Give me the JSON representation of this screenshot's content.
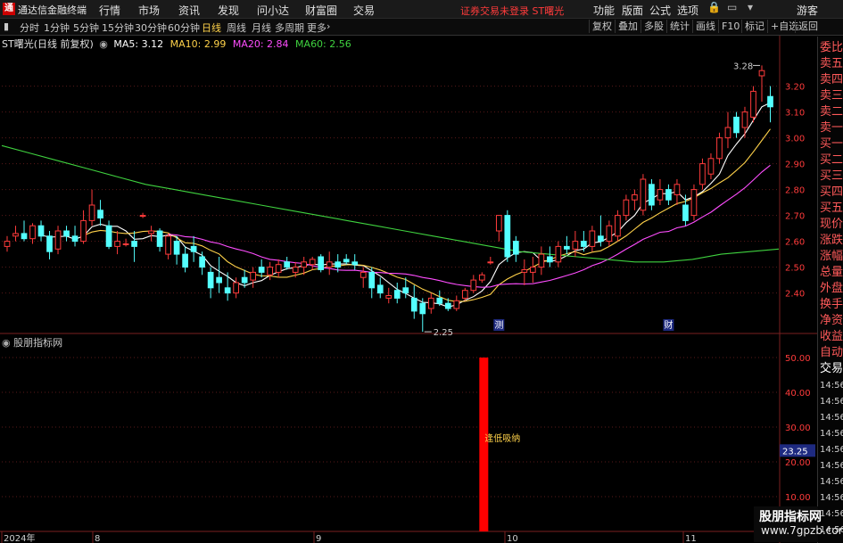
{
  "window": {
    "app_title": "通达信金融终端",
    "logo": "通",
    "menus": [
      "行情",
      "市场",
      "资讯",
      "发现",
      "问小达",
      "财富圈",
      "交易"
    ],
    "login_warning": "证券交易未登录  ST曙光",
    "right_menus": [
      "功能",
      "版面",
      "公式",
      "选项"
    ],
    "guest": "游客"
  },
  "toolbar": {
    "periods": [
      "分时",
      "1分钟",
      "5分钟",
      "15分钟",
      "30分钟",
      "60分钟",
      "日线",
      "周线",
      "月线",
      "多周期",
      "更多"
    ],
    "active_period": "日线",
    "buttons": [
      "复权",
      "叠加",
      "多股",
      "统计",
      "画线",
      "F10",
      "标记",
      "+自选",
      "返回"
    ]
  },
  "legend": {
    "stock": "ST曙光(日线 前复权)",
    "ma": [
      {
        "label": "MA5: 3.12",
        "color": "#ffffff"
      },
      {
        "label": "MA10: 2.99",
        "color": "#ffd24a"
      },
      {
        "label": "MA20: 2.84",
        "color": "#ff4dff"
      },
      {
        "label": "MA60: 2.56",
        "color": "#3fd23f"
      }
    ]
  },
  "price_axis": [
    "3.20",
    "3.10",
    "3.00",
    "2.90",
    "2.80",
    "2.70",
    "2.60",
    "2.50",
    "2.40"
  ],
  "annotations": {
    "high": "3.28",
    "low": "2.25",
    "marker1": "测",
    "marker2": "财"
  },
  "indicator": {
    "title": "股朋指标网",
    "signal_label": "逢低吸纳",
    "axis": [
      "50.00",
      "40.00",
      "30.00",
      "20.00",
      "10.00"
    ],
    "current": "23.25"
  },
  "dates": {
    "year": "2024年",
    "m8": "8",
    "m9": "9",
    "m10": "10",
    "m11": "11"
  },
  "right_panel": {
    "quote_labels": [
      "委比",
      "卖五",
      "卖四",
      "卖三",
      "卖二",
      "卖一",
      "买一",
      "买二",
      "买三",
      "买四",
      "买五",
      "现价",
      "涨跌",
      "涨幅",
      "总量",
      "外盘",
      "换手",
      "净资",
      "收益"
    ],
    "tabs": [
      "自动",
      "交易"
    ],
    "times": [
      "14:56",
      "14:56",
      "14:56",
      "14:56",
      "14:56",
      "14:56",
      "14:56",
      "14:56",
      "14:56",
      "14:56"
    ]
  },
  "watermark": {
    "line1": "股朋指标网",
    "line2": "www.7gpzb.com"
  },
  "colors": {
    "up": "#ff3b3b",
    "down": "#54ffff",
    "ma5": "#ffffff",
    "ma10": "#ffd24a",
    "ma20": "#ff4dff",
    "ma60": "#3fd23f",
    "signal": "#ff0000"
  },
  "chart_data": {
    "type": "candlestick",
    "ylim": [
      2.25,
      3.28
    ],
    "candles": [
      {
        "o": 2.58,
        "h": 2.62,
        "l": 2.56,
        "c": 2.6
      },
      {
        "o": 2.62,
        "h": 2.66,
        "l": 2.6,
        "c": 2.63
      },
      {
        "o": 2.63,
        "h": 2.68,
        "l": 2.6,
        "c": 2.61
      },
      {
        "o": 2.61,
        "h": 2.67,
        "l": 2.59,
        "c": 2.66
      },
      {
        "o": 2.66,
        "h": 2.68,
        "l": 2.6,
        "c": 2.62
      },
      {
        "o": 2.62,
        "h": 2.64,
        "l": 2.53,
        "c": 2.56
      },
      {
        "o": 2.57,
        "h": 2.66,
        "l": 2.55,
        "c": 2.64
      },
      {
        "o": 2.64,
        "h": 2.66,
        "l": 2.6,
        "c": 2.62
      },
      {
        "o": 2.62,
        "h": 2.66,
        "l": 2.58,
        "c": 2.6
      },
      {
        "o": 2.6,
        "h": 2.72,
        "l": 2.59,
        "c": 2.68
      },
      {
        "o": 2.68,
        "h": 2.8,
        "l": 2.66,
        "c": 2.74
      },
      {
        "o": 2.72,
        "h": 2.76,
        "l": 2.66,
        "c": 2.69
      },
      {
        "o": 2.66,
        "h": 2.68,
        "l": 2.57,
        "c": 2.58
      },
      {
        "o": 2.58,
        "h": 2.64,
        "l": 2.55,
        "c": 2.6
      },
      {
        "o": 2.59,
        "h": 2.61,
        "l": 2.58,
        "c": 2.59
      },
      {
        "o": 2.6,
        "h": 2.64,
        "l": 2.52,
        "c": 2.58
      },
      {
        "o": 2.7,
        "h": 2.71,
        "l": 2.69,
        "c": 2.7
      },
      {
        "o": 2.63,
        "h": 2.66,
        "l": 2.6,
        "c": 2.64
      },
      {
        "o": 2.64,
        "h": 2.65,
        "l": 2.56,
        "c": 2.58
      },
      {
        "o": 2.55,
        "h": 2.63,
        "l": 2.53,
        "c": 2.62
      },
      {
        "o": 2.6,
        "h": 2.62,
        "l": 2.51,
        "c": 2.55
      },
      {
        "o": 2.55,
        "h": 2.58,
        "l": 2.48,
        "c": 2.5
      },
      {
        "o": 2.58,
        "h": 2.62,
        "l": 2.52,
        "c": 2.56
      },
      {
        "o": 2.54,
        "h": 2.56,
        "l": 2.47,
        "c": 2.5
      },
      {
        "o": 2.48,
        "h": 2.5,
        "l": 2.38,
        "c": 2.42
      },
      {
        "o": 2.46,
        "h": 2.54,
        "l": 2.4,
        "c": 2.44
      },
      {
        "o": 2.42,
        "h": 2.48,
        "l": 2.37,
        "c": 2.4
      },
      {
        "o": 2.4,
        "h": 2.46,
        "l": 2.38,
        "c": 2.44
      },
      {
        "o": 2.46,
        "h": 2.49,
        "l": 2.42,
        "c": 2.44
      },
      {
        "o": 2.45,
        "h": 2.5,
        "l": 2.42,
        "c": 2.48
      },
      {
        "o": 2.5,
        "h": 2.53,
        "l": 2.46,
        "c": 2.48
      },
      {
        "o": 2.47,
        "h": 2.52,
        "l": 2.45,
        "c": 2.5
      },
      {
        "o": 2.48,
        "h": 2.53,
        "l": 2.46,
        "c": 2.51
      },
      {
        "o": 2.52,
        "h": 2.54,
        "l": 2.49,
        "c": 2.5
      },
      {
        "o": 2.48,
        "h": 2.52,
        "l": 2.46,
        "c": 2.5
      },
      {
        "o": 2.5,
        "h": 2.54,
        "l": 2.47,
        "c": 2.52
      },
      {
        "o": 2.51,
        "h": 2.54,
        "l": 2.49,
        "c": 2.53
      },
      {
        "o": 2.54,
        "h": 2.55,
        "l": 2.48,
        "c": 2.49
      },
      {
        "o": 2.5,
        "h": 2.56,
        "l": 2.47,
        "c": 2.52
      },
      {
        "o": 2.52,
        "h": 2.55,
        "l": 2.48,
        "c": 2.5
      },
      {
        "o": 2.53,
        "h": 2.55,
        "l": 2.51,
        "c": 2.52
      },
      {
        "o": 2.52,
        "h": 2.55,
        "l": 2.49,
        "c": 2.51
      },
      {
        "o": 2.46,
        "h": 2.5,
        "l": 2.42,
        "c": 2.48
      },
      {
        "o": 2.48,
        "h": 2.5,
        "l": 2.38,
        "c": 2.42
      },
      {
        "o": 2.43,
        "h": 2.46,
        "l": 2.38,
        "c": 2.4
      },
      {
        "o": 2.38,
        "h": 2.42,
        "l": 2.36,
        "c": 2.39
      },
      {
        "o": 2.41,
        "h": 2.44,
        "l": 2.36,
        "c": 2.38
      },
      {
        "o": 2.42,
        "h": 2.46,
        "l": 2.38,
        "c": 2.4
      },
      {
        "o": 2.38,
        "h": 2.43,
        "l": 2.3,
        "c": 2.33
      },
      {
        "o": 2.36,
        "h": 2.38,
        "l": 2.25,
        "c": 2.32
      },
      {
        "o": 2.34,
        "h": 2.4,
        "l": 2.32,
        "c": 2.38
      },
      {
        "o": 2.38,
        "h": 2.41,
        "l": 2.35,
        "c": 2.36
      },
      {
        "o": 2.36,
        "h": 2.38,
        "l": 2.33,
        "c": 2.34
      },
      {
        "o": 2.34,
        "h": 2.39,
        "l": 2.33,
        "c": 2.37
      },
      {
        "o": 2.38,
        "h": 2.42,
        "l": 2.37,
        "c": 2.41
      },
      {
        "o": 2.41,
        "h": 2.47,
        "l": 2.4,
        "c": 2.45
      },
      {
        "o": 2.45,
        "h": 2.48,
        "l": 2.44,
        "c": 2.47
      },
      {
        "o": 2.52,
        "h": 2.54,
        "l": 2.51,
        "c": 2.52
      },
      {
        "o": 2.64,
        "h": 2.7,
        "l": 2.6,
        "c": 2.7
      },
      {
        "o": 2.7,
        "h": 2.72,
        "l": 2.52,
        "c": 2.54
      },
      {
        "o": 2.6,
        "h": 2.62,
        "l": 2.52,
        "c": 2.55
      },
      {
        "o": 2.48,
        "h": 2.53,
        "l": 2.43,
        "c": 2.49
      },
      {
        "o": 2.48,
        "h": 2.54,
        "l": 2.44,
        "c": 2.5
      },
      {
        "o": 2.5,
        "h": 2.58,
        "l": 2.47,
        "c": 2.55
      },
      {
        "o": 2.54,
        "h": 2.58,
        "l": 2.5,
        "c": 2.52
      },
      {
        "o": 2.52,
        "h": 2.6,
        "l": 2.5,
        "c": 2.58
      },
      {
        "o": 2.58,
        "h": 2.62,
        "l": 2.55,
        "c": 2.57
      },
      {
        "o": 2.57,
        "h": 2.64,
        "l": 2.54,
        "c": 2.6
      },
      {
        "o": 2.6,
        "h": 2.64,
        "l": 2.56,
        "c": 2.58
      },
      {
        "o": 2.58,
        "h": 2.66,
        "l": 2.56,
        "c": 2.64
      },
      {
        "o": 2.62,
        "h": 2.7,
        "l": 2.58,
        "c": 2.6
      },
      {
        "o": 2.6,
        "h": 2.68,
        "l": 2.58,
        "c": 2.66
      },
      {
        "o": 2.62,
        "h": 2.72,
        "l": 2.6,
        "c": 2.7
      },
      {
        "o": 2.7,
        "h": 2.78,
        "l": 2.68,
        "c": 2.76
      },
      {
        "o": 2.76,
        "h": 2.8,
        "l": 2.72,
        "c": 2.78
      },
      {
        "o": 2.72,
        "h": 2.86,
        "l": 2.7,
        "c": 2.84
      },
      {
        "o": 2.82,
        "h": 2.84,
        "l": 2.72,
        "c": 2.74
      },
      {
        "o": 2.76,
        "h": 2.84,
        "l": 2.74,
        "c": 2.8
      },
      {
        "o": 2.8,
        "h": 2.82,
        "l": 2.74,
        "c": 2.76
      },
      {
        "o": 2.78,
        "h": 2.84,
        "l": 2.74,
        "c": 2.82
      },
      {
        "o": 2.74,
        "h": 2.78,
        "l": 2.66,
        "c": 2.68
      },
      {
        "o": 2.7,
        "h": 2.82,
        "l": 2.68,
        "c": 2.8
      },
      {
        "o": 2.82,
        "h": 2.92,
        "l": 2.8,
        "c": 2.9
      },
      {
        "o": 2.86,
        "h": 2.94,
        "l": 2.84,
        "c": 2.92
      },
      {
        "o": 2.92,
        "h": 3.02,
        "l": 2.9,
        "c": 3.0
      },
      {
        "o": 3.0,
        "h": 3.1,
        "l": 2.96,
        "c": 3.04
      },
      {
        "o": 3.08,
        "h": 3.1,
        "l": 3.0,
        "c": 3.02
      },
      {
        "o": 3.04,
        "h": 3.12,
        "l": 3.0,
        "c": 3.1
      },
      {
        "o": 3.08,
        "h": 3.2,
        "l": 3.06,
        "c": 3.18
      },
      {
        "o": 3.24,
        "h": 3.28,
        "l": 3.14,
        "c": 3.26
      },
      {
        "o": 3.16,
        "h": 3.2,
        "l": 3.06,
        "c": 3.12
      }
    ],
    "ma60": [
      2.97,
      2.94,
      2.91,
      2.88,
      2.85,
      2.82,
      2.8,
      2.78,
      2.76,
      2.74,
      2.72,
      2.7,
      2.68,
      2.66,
      2.64,
      2.62,
      2.6,
      2.58,
      2.56,
      2.55,
      2.54,
      2.53,
      2.52,
      2.52,
      2.53,
      2.55,
      2.56,
      2.57
    ],
    "signal_value": 50
  }
}
